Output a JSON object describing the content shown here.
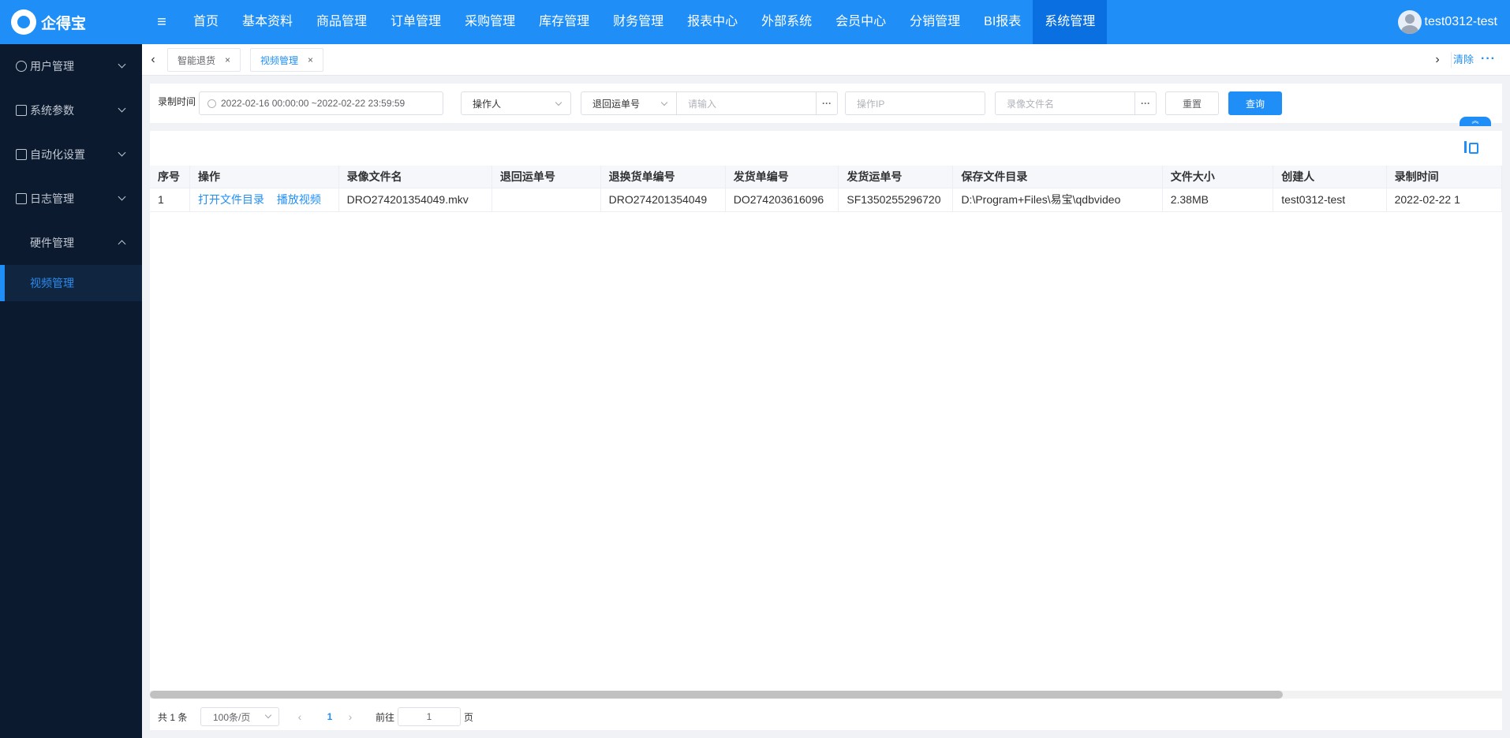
{
  "app": {
    "logo_text": "企得宝"
  },
  "topnav": {
    "items": [
      "首页",
      "基本资料",
      "商品管理",
      "订单管理",
      "采购管理",
      "库存管理",
      "财务管理",
      "报表中心",
      "外部系统",
      "会员中心",
      "分销管理",
      "BI报表",
      "系统管理"
    ],
    "active": "系统管理",
    "username": "test0312-test"
  },
  "sidebar": {
    "items": [
      {
        "label": "用户管理",
        "icon": "user-icon"
      },
      {
        "label": "系统参数",
        "icon": "document-icon"
      },
      {
        "label": "自动化设置",
        "icon": "clipboard-icon"
      },
      {
        "label": "日志管理",
        "icon": "calendar-icon"
      }
    ],
    "group": "硬件管理",
    "active_sub": "视频管理"
  },
  "tabs": {
    "items": [
      {
        "label": "智能退货",
        "close": "×"
      },
      {
        "label": "视频管理",
        "close": "×"
      }
    ],
    "prev_glyph": "‹",
    "next_glyph": "›",
    "clear_label": "清除",
    "more_label": "···"
  },
  "filter": {
    "record_time_label": "录制时间",
    "record_time_value": "2022-02-16 00:00:00 ~2022-02-22 23:59:59",
    "operator_placeholder": "操作人",
    "return_no_type": "退回运单号",
    "return_no_placeholder": "请输入",
    "dots": "···",
    "ip_placeholder": "操作IP",
    "filename_placeholder": "录像文件名",
    "reset_label": "重置",
    "query_label": "查询",
    "collapse_glyph": "︽"
  },
  "table": {
    "columns": [
      "序号",
      "操作",
      "录像文件名",
      "退回运单号",
      "退换货单编号",
      "发货单编号",
      "发货运单号",
      "保存文件目录",
      "文件大小",
      "创建人",
      "录制时间"
    ],
    "rows": [
      {
        "index": "1",
        "actions": [
          "打开文件目录",
          "播放视频"
        ],
        "filename": "DRO274201354049.mkv",
        "return_tracking": "",
        "exchange_no": "DRO274201354049",
        "delivery_no": "DO274203616096",
        "delivery_tracking": "SF1350255296720",
        "save_dir": "D:\\Program+Files\\易宝\\qdbvideo",
        "file_size": "2.38MB",
        "creator": "test0312-test",
        "record_time": "2022-02-22 1"
      }
    ]
  },
  "pagination": {
    "total_text": "共 1 条",
    "page_size": "100条/页",
    "prev": "‹",
    "next": "›",
    "current": "1",
    "goto_label": "前往",
    "goto_value": "1",
    "page_suffix": "页"
  }
}
